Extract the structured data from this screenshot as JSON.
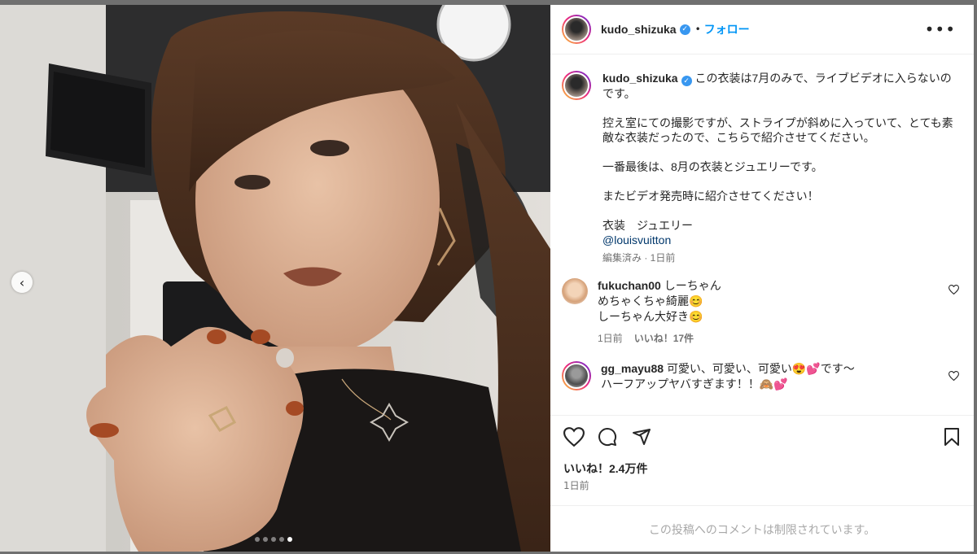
{
  "post": {
    "username": "kudo_shizuka",
    "follow_label": "フォロー",
    "separator": "•",
    "more_label": "•••",
    "caption_lines": [
      "この衣装は7月のみで、ライブビデオに入らないのです。",
      "",
      "控え室にての撮影ですが、ストライプが斜めに入っていて、とても素敵な衣装だったので、こちらで紹介させてください。",
      "",
      "一番最後は、8月の衣装とジュエリーです。",
      "",
      "またビデオ発売時に紹介させてください！",
      "",
      "衣装　ジュエリー"
    ],
    "mention": "@louisvuitton",
    "caption_meta": "編集済み · 1日前",
    "likes": "いいね！2.4万件",
    "time_ago": "1日前",
    "restricted_note": "この投稿へのコメントは制限されています。"
  },
  "comments": [
    {
      "username": "fukuchan00",
      "text_lines": [
        "しーちゃん",
        "めちゃくちゃ綺麗😊",
        "しーちゃん大好き😊"
      ],
      "time": "1日前",
      "likes": "いいね！17件"
    },
    {
      "username": "gg_mayu88",
      "text_lines": [
        "可愛い、可愛い、可愛い😍💕です〜",
        "ハーフアップヤバすぎます！！🙈💕"
      ]
    }
  ],
  "carousel": {
    "prev_icon": "chevron-left-icon",
    "prev_glyph": "‹",
    "slide_count": 5,
    "active_slide": 5
  },
  "colors": {
    "accent": "#0095f6",
    "verified": "#3897f0",
    "muted": "#737373"
  }
}
